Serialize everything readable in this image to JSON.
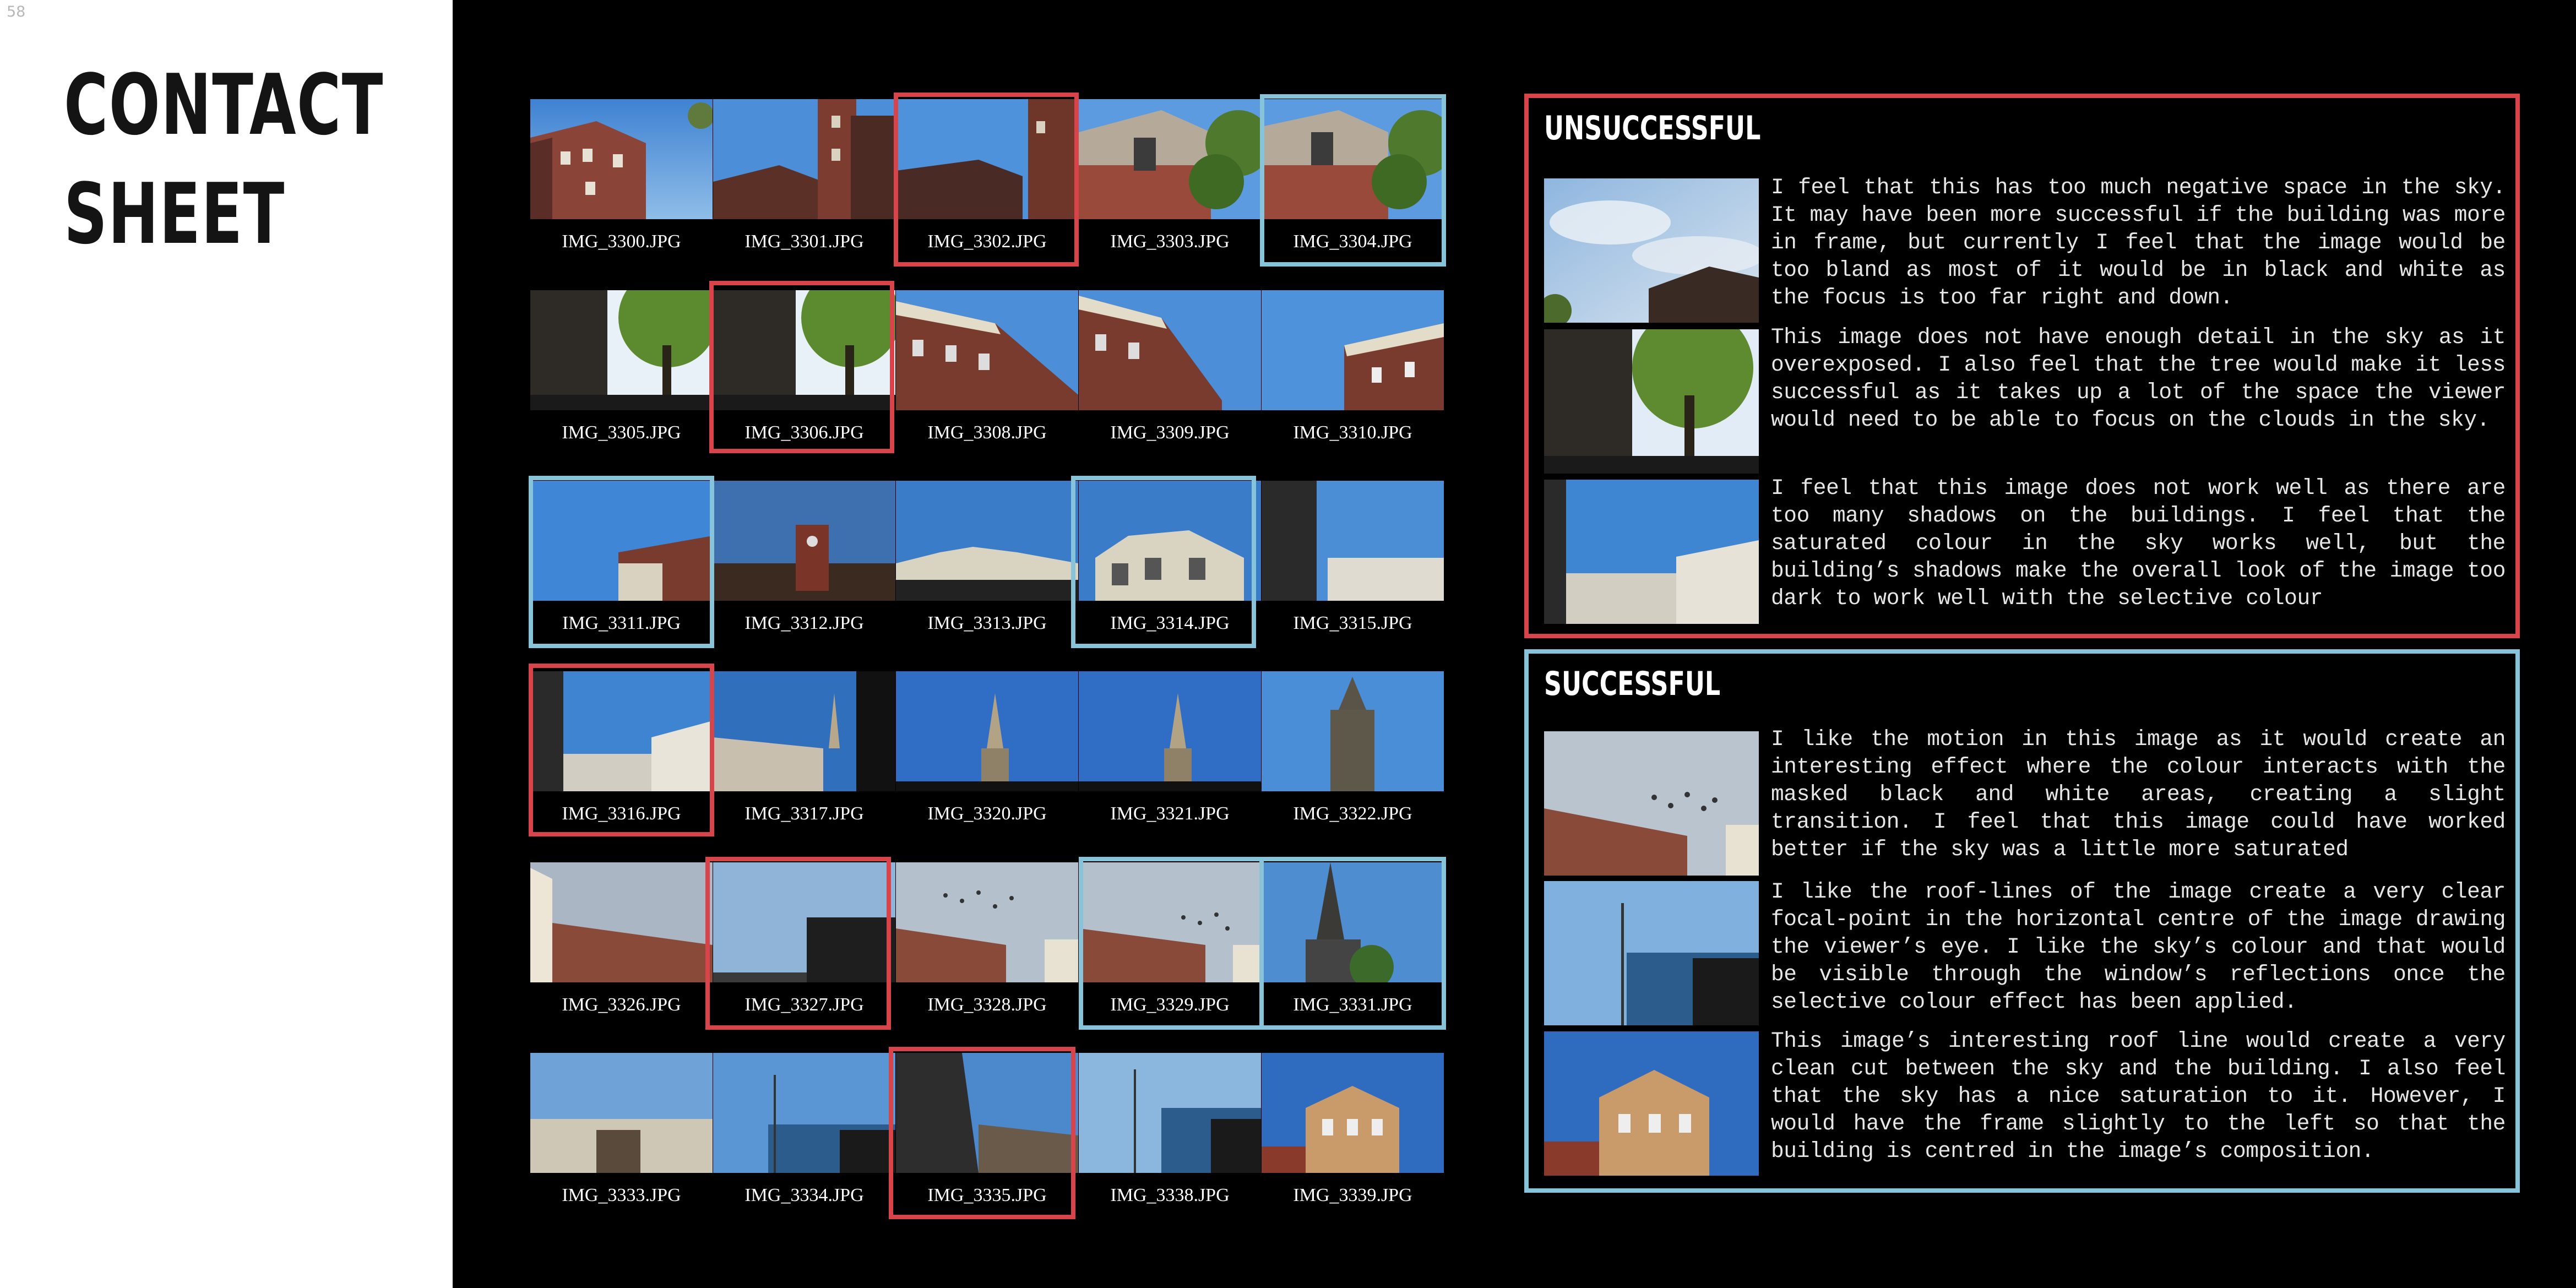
{
  "page_number": "58",
  "title_lines": [
    "CONTACT",
    "SHEET"
  ],
  "thumbnails": [
    {
      "file": "IMG_3300.JPG",
      "selection": "none"
    },
    {
      "file": "IMG_3301.JPG",
      "selection": "none"
    },
    {
      "file": "IMG_3302.JPG",
      "selection": "unsuccessful"
    },
    {
      "file": "IMG_3303.JPG",
      "selection": "none"
    },
    {
      "file": "IMG_3304.JPG",
      "selection": "successful"
    },
    {
      "file": "IMG_3305.JPG",
      "selection": "none"
    },
    {
      "file": "IMG_3306.JPG",
      "selection": "unsuccessful"
    },
    {
      "file": "IMG_3308.JPG",
      "selection": "none"
    },
    {
      "file": "IMG_3309.JPG",
      "selection": "none"
    },
    {
      "file": "IMG_3310.JPG",
      "selection": "none"
    },
    {
      "file": "IMG_3311.JPG",
      "selection": "successful"
    },
    {
      "file": "IMG_3312.JPG",
      "selection": "none"
    },
    {
      "file": "IMG_3313.JPG",
      "selection": "none"
    },
    {
      "file": "IMG_3314.JPG",
      "selection": "successful"
    },
    {
      "file": "IMG_3315.JPG",
      "selection": "none"
    },
    {
      "file": "IMG_3316.JPG",
      "selection": "unsuccessful"
    },
    {
      "file": "IMG_3317.JPG",
      "selection": "none"
    },
    {
      "file": "IMG_3320.JPG",
      "selection": "none"
    },
    {
      "file": "IMG_3321.JPG",
      "selection": "none"
    },
    {
      "file": "IMG_3322.JPG",
      "selection": "none"
    },
    {
      "file": "IMG_3326.JPG",
      "selection": "none"
    },
    {
      "file": "IMG_3327.JPG",
      "selection": "unsuccessful"
    },
    {
      "file": "IMG_3328.JPG",
      "selection": "none"
    },
    {
      "file": "IMG_3329.JPG",
      "selection": "successful"
    },
    {
      "file": "IMG_3331.JPG",
      "selection": "successful"
    },
    {
      "file": "IMG_3333.JPG",
      "selection": "none"
    },
    {
      "file": "IMG_3334.JPG",
      "selection": "none"
    },
    {
      "file": "IMG_3335.JPG",
      "selection": "unsuccessful"
    },
    {
      "file": "IMG_3338.JPG",
      "selection": "none"
    },
    {
      "file": "IMG_3339.JPG",
      "selection": "none"
    }
  ],
  "unsuccessful": {
    "heading": "UNSUCCESSFUL",
    "entries": [
      {
        "text": "I feel that this has too much negative space in the sky. It may have been more successful if the building was more in frame, but currently I feel that the image would be too bland as most of it would be in black and white as the focus is too far right and down."
      },
      {
        "text": "This image does not have enough detail in the sky as it overexposed. I also feel that the tree would make it less successful as it takes up a lot of the space the viewer would need to be able to focus on the clouds in the sky."
      },
      {
        "text": "I feel that this image does not work well as there are too many shadows on the buildings. I feel that the saturated colour in the sky works well, but the building’s shadows make the overall look of the image too dark to work well with the selective colour"
      }
    ]
  },
  "successful": {
    "heading": "SUCCESSFUL",
    "entries": [
      {
        "text": "I like the motion in this image as it would create an interesting effect where the colour interacts with the masked black and white areas, creating a slight transition. I feel that this image could have worked better if the sky was a little more saturated"
      },
      {
        "text": "I like the roof-lines of the image create a very clear focal-point in the horizontal centre of the image drawing the viewer’s eye. I like the sky’s colour and that would be visible through the window’s reflections once the selective colour effect has been applied."
      },
      {
        "text": "This image’s interesting roof line would create a very clean cut between the sky and the building. I also feel that the sky has a nice saturation to it. However, I would have the frame slightly to the left so that the building is centred in the image’s composition."
      }
    ]
  },
  "colors": {
    "unsuccessful_frame": "#d9434a",
    "successful_frame": "#87c4da",
    "background": "#000000",
    "sidebar": "#ffffff"
  }
}
